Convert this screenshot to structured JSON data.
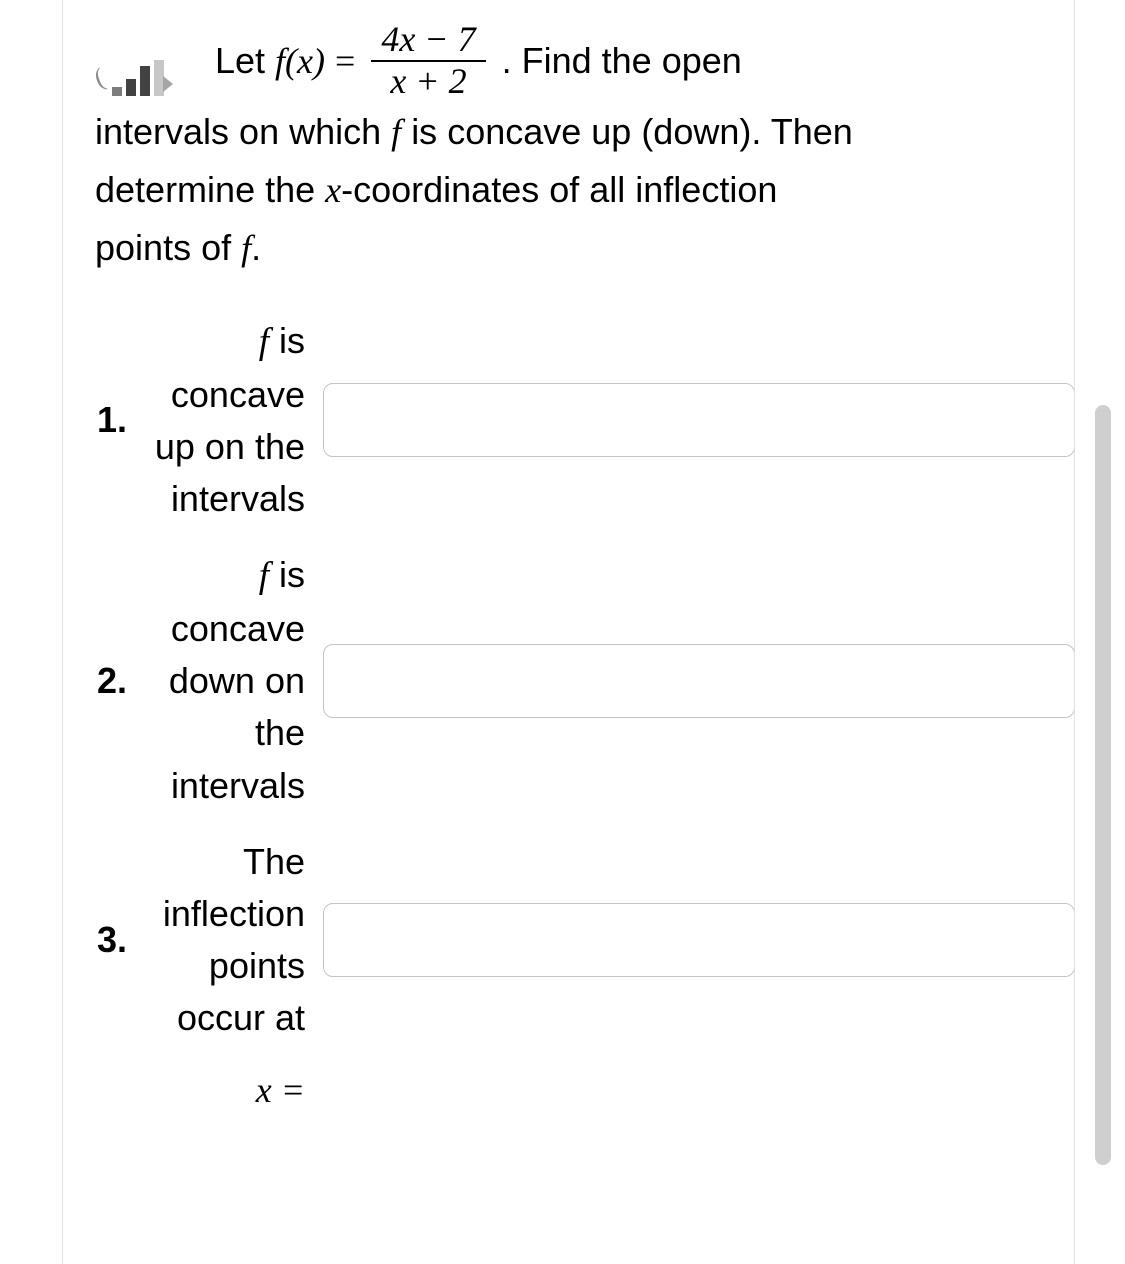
{
  "problem": {
    "let_prefix": "Let",
    "func": "f(x)",
    "eq": "=",
    "numerator": "4x − 7",
    "denominator": "x + 2",
    "after_frac": ". Find the open",
    "line2": "intervals on which",
    "line2_f": "f",
    "line2_rest": "is concave up (down). Then",
    "line3": "determine the ",
    "line3_x": "x",
    "line3_rest": "-coordinates of all inflection",
    "line4": "points of ",
    "line4_f": "f",
    "line4_end": "."
  },
  "answers": [
    {
      "num": "1.",
      "label_pre_f": "",
      "label_f": "f",
      "label_post": " is concave up on the intervals",
      "value": "",
      "placeholder": ""
    },
    {
      "num": "2.",
      "label_pre_f": "",
      "label_f": "f",
      "label_post": " is concave down on the intervals",
      "value": "",
      "placeholder": ""
    },
    {
      "num": "3.",
      "label_plain": "The inflection points occur at",
      "x_eq": "x =",
      "value": "",
      "placeholder": ""
    }
  ]
}
